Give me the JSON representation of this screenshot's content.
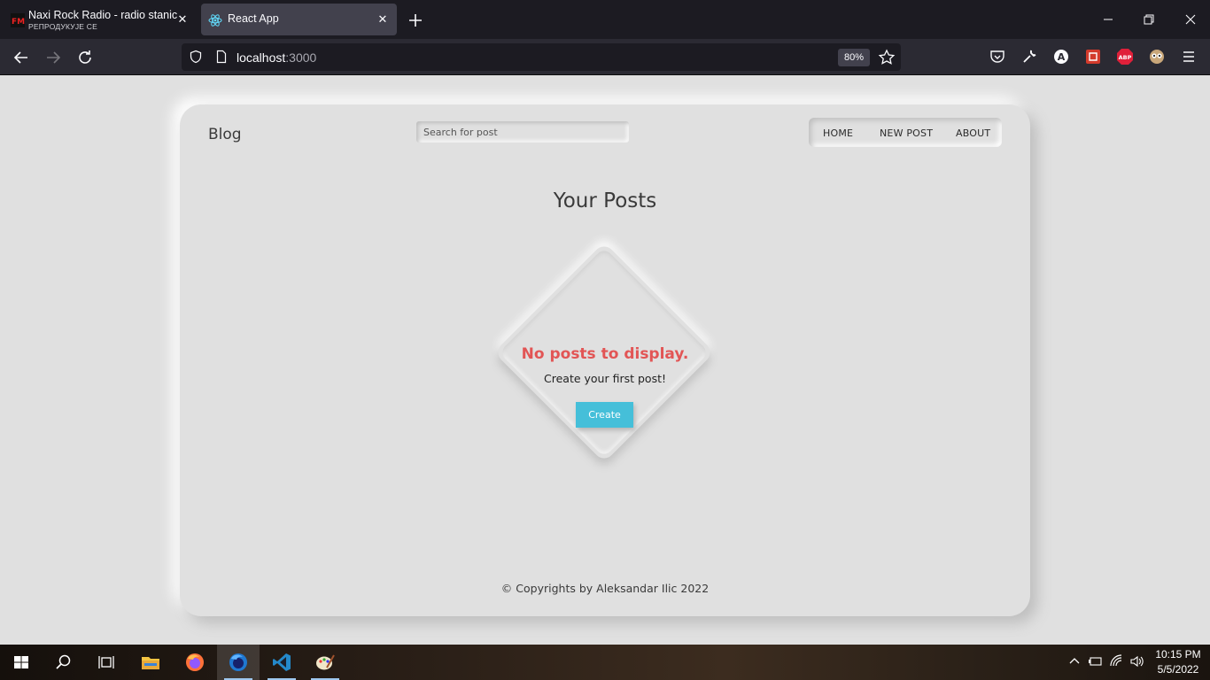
{
  "browser": {
    "tabs": [
      {
        "title": "Naxi Rock Radio - radio stanice",
        "subtitle": "РЕПРОДУКУЈЕ СЕ",
        "favicon": "fm-radio-icon"
      },
      {
        "title": "React App",
        "favicon": "react-icon"
      }
    ],
    "url": {
      "host": "localhost",
      "port": ":3000"
    },
    "zoom": "80%"
  },
  "app": {
    "brand": "Blog",
    "search": {
      "placeholder": "Search for post",
      "value": ""
    },
    "nav": [
      "HOME",
      "NEW POST",
      "ABOUT"
    ],
    "heading": "Your Posts",
    "empty": {
      "title": "No posts to display.",
      "subtitle": "Create your first post!",
      "button": "Create"
    },
    "footer": "© Copyrights by Aleksandar Ilic 2022"
  },
  "taskbar": {
    "items": [
      "windows-start-icon",
      "search-icon",
      "task-view-icon",
      "file-explorer-icon",
      "firefox-icon",
      "firefox-developer-icon",
      "vscode-icon",
      "paint-icon"
    ],
    "time": "10:15 PM",
    "date": "5/5/2022"
  },
  "colors": {
    "accent": "#45bfd9",
    "error": "#e25555",
    "background": "#e0e0e0"
  }
}
